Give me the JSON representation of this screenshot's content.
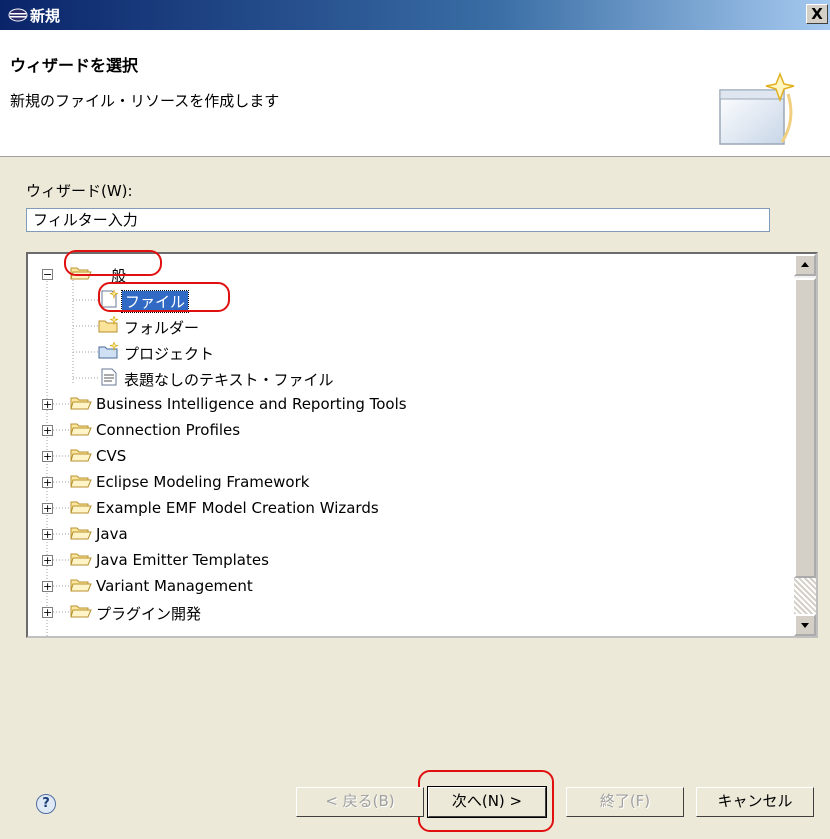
{
  "window": {
    "title": "新規",
    "close_label": "X"
  },
  "banner": {
    "title": "ウィザードを選択",
    "description": "新規のファイル・リソースを作成します"
  },
  "wizard": {
    "label": "ウィザード(W):",
    "filter_value": "フィルター入力",
    "tree": [
      {
        "label": "一般",
        "expanded": true,
        "children": [
          {
            "label": "ファイル",
            "selected": true
          },
          {
            "label": "フォルダー"
          },
          {
            "label": "プロジェクト"
          },
          {
            "label": "表題なしのテキスト・ファイル"
          }
        ]
      },
      {
        "label": "Business Intelligence and Reporting Tools"
      },
      {
        "label": "Connection Profiles"
      },
      {
        "label": "CVS"
      },
      {
        "label": "Eclipse Modeling Framework"
      },
      {
        "label": "Example EMF Model Creation Wizards"
      },
      {
        "label": "Java"
      },
      {
        "label": "Java Emitter Templates"
      },
      {
        "label": "Variant Management"
      },
      {
        "label": "プラグイン開発"
      }
    ]
  },
  "footer": {
    "help_icon": "?",
    "back_label": "< 戻る(B)",
    "next_label": "次へ(N) >",
    "finish_label": "終了(F)",
    "cancel_label": "キャンセル"
  },
  "colors": {
    "selection": "#316ac5",
    "annotation": "#e01010",
    "titlebar": "#0a246a"
  }
}
